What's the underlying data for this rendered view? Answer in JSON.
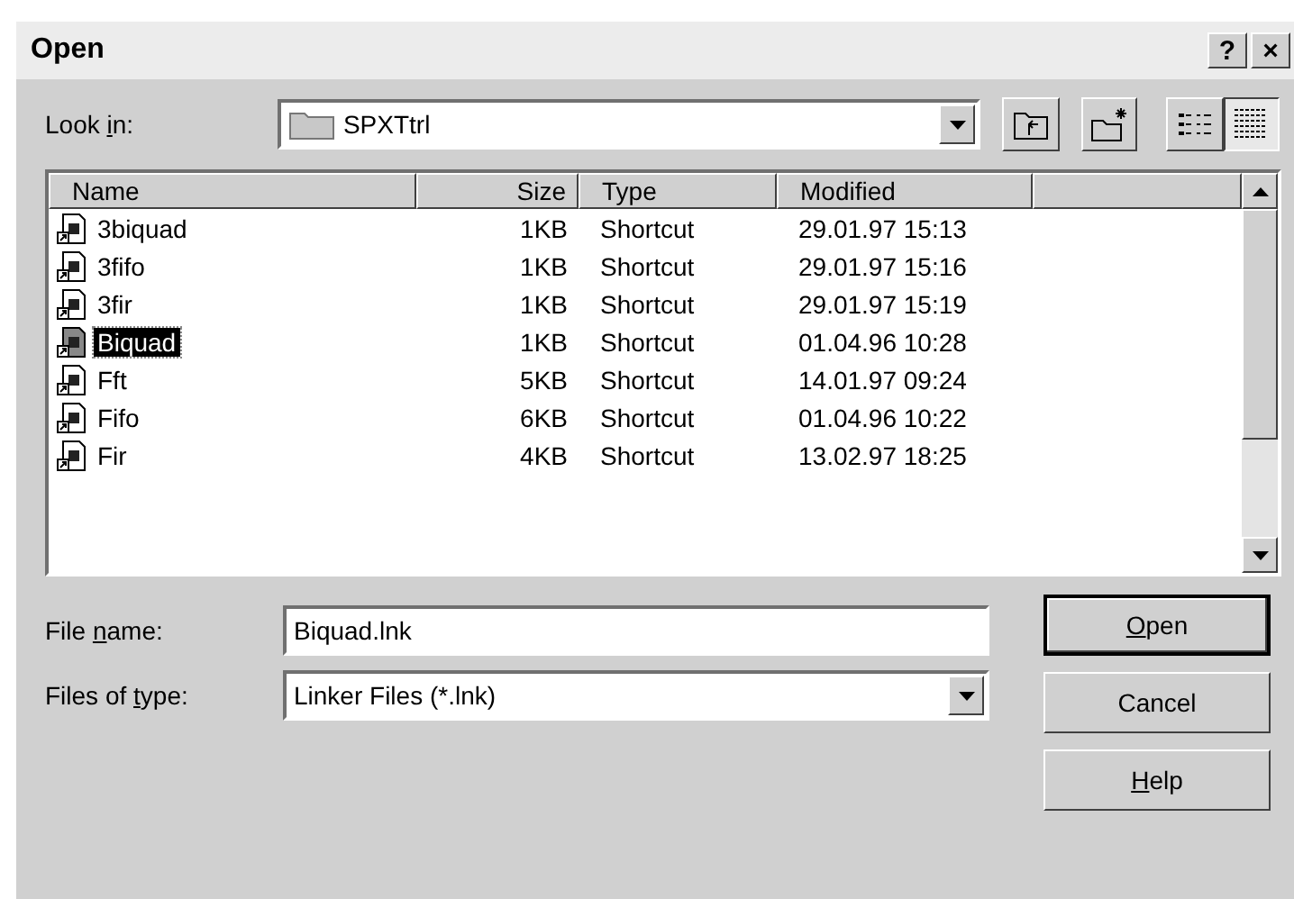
{
  "window": {
    "title": "Open",
    "title_buttons": [
      "?",
      "×"
    ]
  },
  "look_in": {
    "label": {
      "before": "Look ",
      "key": "i",
      "after": "n:"
    },
    "value": "SPXTtrl"
  },
  "toolbar": [
    {
      "kind": "up"
    },
    {
      "kind": "new-folder"
    },
    {
      "kind": "list",
      "selected": false
    },
    {
      "kind": "details",
      "selected": true
    }
  ],
  "table": {
    "columns": [
      "Name",
      "Size",
      "Type",
      "Modified"
    ],
    "rows": [
      {
        "name": "3biquad",
        "size": "1KB",
        "type": "Shortcut",
        "modified": "29.01.97 15:13",
        "selected": false
      },
      {
        "name": "3fifo",
        "size": "1KB",
        "type": "Shortcut",
        "modified": "29.01.97 15:16",
        "selected": false
      },
      {
        "name": "3fir",
        "size": "1KB",
        "type": "Shortcut",
        "modified": "29.01.97 15:19",
        "selected": false
      },
      {
        "name": "Biquad",
        "size": "1KB",
        "type": "Shortcut",
        "modified": "01.04.96 10:28",
        "selected": true
      },
      {
        "name": "Fft",
        "size": "5KB",
        "type": "Shortcut",
        "modified": "14.01.97 09:24",
        "selected": false
      },
      {
        "name": "Fifo",
        "size": "6KB",
        "type": "Shortcut",
        "modified": "01.04.96 10:22",
        "selected": false
      },
      {
        "name": "Fir",
        "size": "4KB",
        "type": "Shortcut",
        "modified": "13.02.97 18:25",
        "selected": false
      }
    ]
  },
  "file_name": {
    "label": {
      "before": "File ",
      "key": "n",
      "after": "ame:"
    },
    "value": "Biquad.lnk"
  },
  "file_type": {
    "label": {
      "before": "Files of ",
      "key": "t",
      "after": "ype:"
    },
    "value": "Linker Files (*.lnk)"
  },
  "buttons": [
    {
      "key": "O",
      "after": "pen",
      "default": true
    },
    {
      "before": "Cancel",
      "default": false
    },
    {
      "key": "H",
      "after": "elp",
      "default": false
    }
  ]
}
